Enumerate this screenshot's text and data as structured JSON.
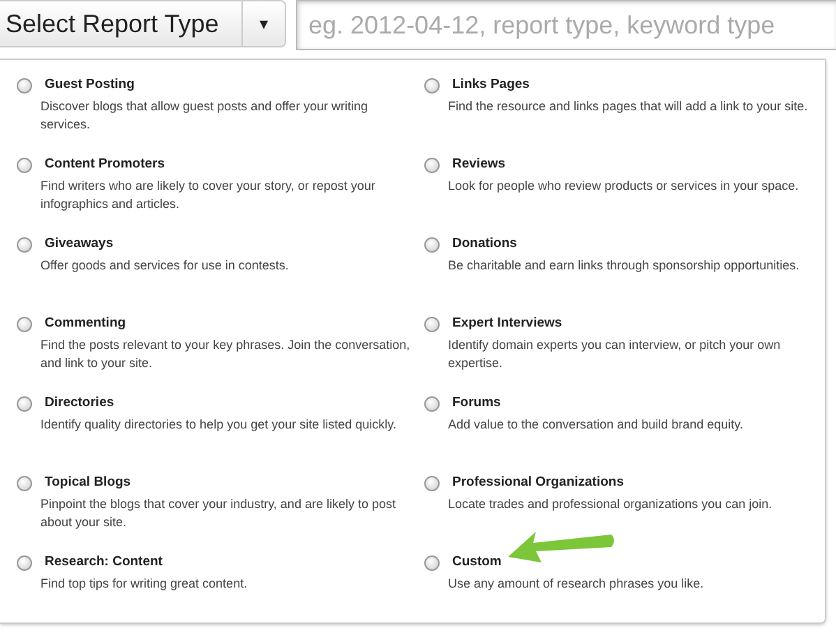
{
  "report_select": {
    "label": "Select Report Type",
    "caret": "▾"
  },
  "search": {
    "placeholder": "eg. 2012-04-12, report type, keyword type"
  },
  "options": [
    {
      "title": "Guest Posting",
      "description": "Discover blogs that allow guest posts and offer your writing services.",
      "selected": false
    },
    {
      "title": "Links Pages",
      "description": "Find the resource and links pages that will add a link to your site.",
      "selected": false
    },
    {
      "title": "Content Promoters",
      "description": "Find writers who are likely to cover your story, or repost your infographics and articles.",
      "selected": false
    },
    {
      "title": "Reviews",
      "description": "Look for people who review products or services in your space.",
      "selected": false
    },
    {
      "title": "Giveaways",
      "description": "Offer goods and services for use in contests.",
      "selected": false
    },
    {
      "title": "Donations",
      "description": "Be charitable and earn links through sponsorship opportunities.",
      "selected": false
    },
    {
      "title": "Commenting",
      "description": "Find the posts relevant to your key phrases. Join the conversation, and link to your site.",
      "selected": false
    },
    {
      "title": "Expert Interviews",
      "description": "Identify domain experts you can interview, or pitch your own expertise.",
      "selected": false
    },
    {
      "title": "Directories",
      "description": "Identify quality directories to help you get your site listed quickly.",
      "selected": false
    },
    {
      "title": "Forums",
      "description": "Add value to the conversation and build brand equity.",
      "selected": false
    },
    {
      "title": "Topical Blogs",
      "description": "Pinpoint the blogs that cover your industry, and are likely to post about your site.",
      "selected": false
    },
    {
      "title": "Professional Organizations",
      "description": "Locate trades and professional organizations you can join.",
      "selected": false
    },
    {
      "title": "Research: Content",
      "description": "Find top tips for writing great content.",
      "selected": false
    },
    {
      "title": "Custom",
      "description": "Use any amount of research phrases you like.",
      "selected": false,
      "highlighted": true
    }
  ]
}
